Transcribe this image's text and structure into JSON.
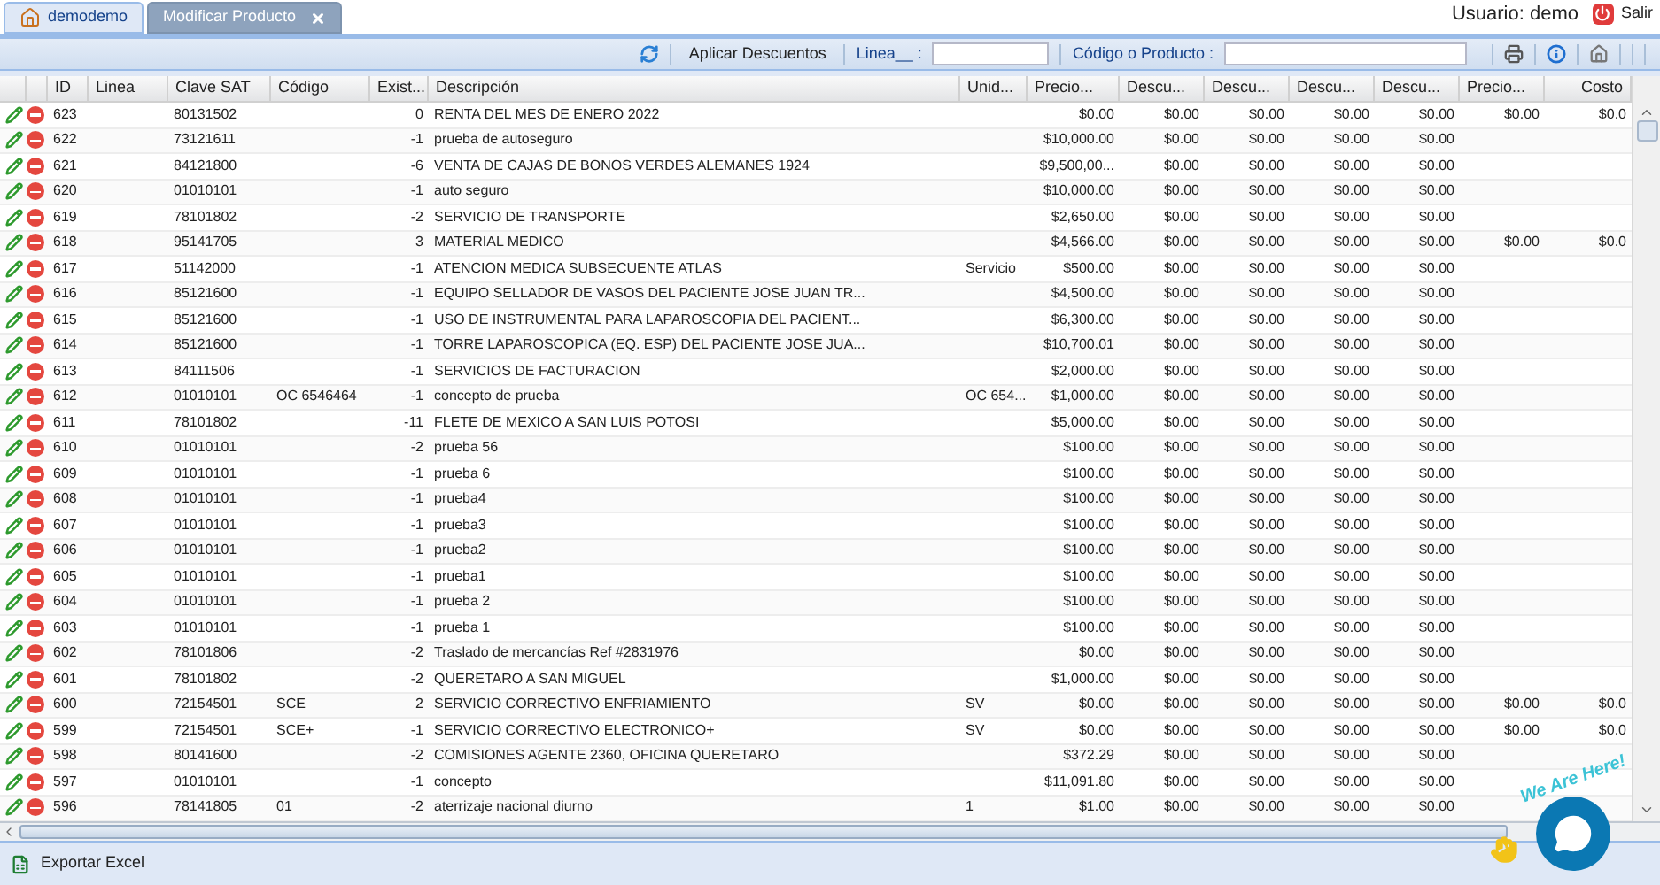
{
  "tabs": [
    {
      "label": "demodemo",
      "kind": "home",
      "selected": false
    },
    {
      "label": "Modificar Producto",
      "kind": "closable",
      "selected": true
    }
  ],
  "user": {
    "label": "Usuario: demo",
    "logout": "Salir"
  },
  "toolbar": {
    "apply_button": "Aplicar Descuentos",
    "linea_label": "Linea__ :",
    "product_label": "Código o Producto :"
  },
  "table": {
    "columns": [
      "ID",
      "Linea",
      "Clave SAT",
      "Código",
      "Exist...",
      "Descripción",
      "Unid...",
      "Precio...",
      "Descu...",
      "Descu...",
      "Descu...",
      "Descu...",
      "Precio...",
      "Costo"
    ],
    "rows": [
      {
        "id": "623",
        "clave_sat": "80131502",
        "existencia": "0",
        "descripcion": "RENTA DEL MES DE ENERO 2022",
        "precio": "$0.00",
        "descuentos": [
          "$0.00",
          "$0.00",
          "$0.00",
          "$0.00"
        ],
        "precio_2": "$0.00",
        "costo": "$0.0"
      },
      {
        "id": "622",
        "clave_sat": "73121611",
        "existencia": "-1",
        "descripcion": "prueba de autoseguro",
        "precio": "$10,000.00",
        "descuentos": [
          "$0.00",
          "$0.00",
          "$0.00",
          "$0.00"
        ]
      },
      {
        "id": "621",
        "clave_sat": "84121800",
        "existencia": "-6",
        "descripcion": "VENTA DE CAJAS DE BONOS VERDES ALEMANES 1924",
        "precio": "$9,500,00...",
        "descuentos": [
          "$0.00",
          "$0.00",
          "$0.00",
          "$0.00"
        ]
      },
      {
        "id": "620",
        "clave_sat": "01010101",
        "existencia": "-1",
        "descripcion": "auto seguro",
        "precio": "$10,000.00",
        "descuentos": [
          "$0.00",
          "$0.00",
          "$0.00",
          "$0.00"
        ]
      },
      {
        "id": "619",
        "clave_sat": "78101802",
        "existencia": "-2",
        "descripcion": "SERVICIO DE TRANSPORTE",
        "precio": "$2,650.00",
        "descuentos": [
          "$0.00",
          "$0.00",
          "$0.00",
          "$0.00"
        ]
      },
      {
        "id": "618",
        "clave_sat": "95141705",
        "existencia": "3",
        "descripcion": "MATERIAL MEDICO",
        "precio": "$4,566.00",
        "descuentos": [
          "$0.00",
          "$0.00",
          "$0.00",
          "$0.00"
        ],
        "precio_2": "$0.00",
        "costo": "$0.0"
      },
      {
        "id": "617",
        "clave_sat": "51142000",
        "existencia": "-1",
        "descripcion": "ATENCION MEDICA SUBSECUENTE ATLAS",
        "unidad": "Servicio",
        "precio": "$500.00",
        "descuentos": [
          "$0.00",
          "$0.00",
          "$0.00",
          "$0.00"
        ]
      },
      {
        "id": "616",
        "clave_sat": "85121600",
        "existencia": "-1",
        "descripcion": "EQUIPO SELLADOR DE VASOS DEL PACIENTE JOSE JUAN TR...",
        "precio": "$4,500.00",
        "descuentos": [
          "$0.00",
          "$0.00",
          "$0.00",
          "$0.00"
        ]
      },
      {
        "id": "615",
        "clave_sat": "85121600",
        "existencia": "-1",
        "descripcion": "USO DE INSTRUMENTAL PARA LAPAROSCOPIA DEL PACIENT...",
        "precio": "$6,300.00",
        "descuentos": [
          "$0.00",
          "$0.00",
          "$0.00",
          "$0.00"
        ]
      },
      {
        "id": "614",
        "clave_sat": "85121600",
        "existencia": "-1",
        "descripcion": "TORRE LAPAROSCOPICA (EQ. ESP) DEL PACIENTE JOSE JUA...",
        "precio": "$10,700.01",
        "descuentos": [
          "$0.00",
          "$0.00",
          "$0.00",
          "$0.00"
        ]
      },
      {
        "id": "613",
        "clave_sat": "84111506",
        "existencia": "-1",
        "descripcion": "SERVICIOS DE FACTURACION",
        "precio": "$2,000.00",
        "descuentos": [
          "$0.00",
          "$0.00",
          "$0.00",
          "$0.00"
        ]
      },
      {
        "id": "612",
        "clave_sat": "01010101",
        "codigo": "OC 6546464",
        "existencia": "-1",
        "descripcion": "concepto de prueba",
        "unidad": "OC 654...",
        "precio": "$1,000.00",
        "descuentos": [
          "$0.00",
          "$0.00",
          "$0.00",
          "$0.00"
        ]
      },
      {
        "id": "611",
        "clave_sat": "78101802",
        "existencia": "-11",
        "descripcion": "FLETE DE MEXICO A SAN LUIS POTOSI",
        "precio": "$5,000.00",
        "descuentos": [
          "$0.00",
          "$0.00",
          "$0.00",
          "$0.00"
        ]
      },
      {
        "id": "610",
        "clave_sat": "01010101",
        "existencia": "-2",
        "descripcion": "prueba 56",
        "precio": "$100.00",
        "descuentos": [
          "$0.00",
          "$0.00",
          "$0.00",
          "$0.00"
        ]
      },
      {
        "id": "609",
        "clave_sat": "01010101",
        "existencia": "-1",
        "descripcion": "prueba 6",
        "precio": "$100.00",
        "descuentos": [
          "$0.00",
          "$0.00",
          "$0.00",
          "$0.00"
        ]
      },
      {
        "id": "608",
        "clave_sat": "01010101",
        "existencia": "-1",
        "descripcion": "prueba4",
        "precio": "$100.00",
        "descuentos": [
          "$0.00",
          "$0.00",
          "$0.00",
          "$0.00"
        ]
      },
      {
        "id": "607",
        "clave_sat": "01010101",
        "existencia": "-1",
        "descripcion": "prueba3",
        "precio": "$100.00",
        "descuentos": [
          "$0.00",
          "$0.00",
          "$0.00",
          "$0.00"
        ]
      },
      {
        "id": "606",
        "clave_sat": "01010101",
        "existencia": "-1",
        "descripcion": "prueba2",
        "precio": "$100.00",
        "descuentos": [
          "$0.00",
          "$0.00",
          "$0.00",
          "$0.00"
        ]
      },
      {
        "id": "605",
        "clave_sat": "01010101",
        "existencia": "-1",
        "descripcion": "prueba1",
        "precio": "$100.00",
        "descuentos": [
          "$0.00",
          "$0.00",
          "$0.00",
          "$0.00"
        ]
      },
      {
        "id": "604",
        "clave_sat": "01010101",
        "existencia": "-1",
        "descripcion": "prueba 2",
        "precio": "$100.00",
        "descuentos": [
          "$0.00",
          "$0.00",
          "$0.00",
          "$0.00"
        ]
      },
      {
        "id": "603",
        "clave_sat": "01010101",
        "existencia": "-1",
        "descripcion": "prueba 1",
        "precio": "$100.00",
        "descuentos": [
          "$0.00",
          "$0.00",
          "$0.00",
          "$0.00"
        ]
      },
      {
        "id": "602",
        "clave_sat": "78101806",
        "existencia": "-2",
        "descripcion": "Traslado de mercancías Ref #2831976",
        "precio": "$0.00",
        "descuentos": [
          "$0.00",
          "$0.00",
          "$0.00",
          "$0.00"
        ]
      },
      {
        "id": "601",
        "clave_sat": "78101802",
        "existencia": "-2",
        "descripcion": "QUERETARO A SAN MIGUEL",
        "precio": "$1,000.00",
        "descuentos": [
          "$0.00",
          "$0.00",
          "$0.00",
          "$0.00"
        ]
      },
      {
        "id": "600",
        "clave_sat": "72154501",
        "codigo": "SCE",
        "existencia": "2",
        "descripcion": "SERVICIO CORRECTIVO ENFRIAMIENTO",
        "unidad": "SV",
        "precio": "$0.00",
        "descuentos": [
          "$0.00",
          "$0.00",
          "$0.00",
          "$0.00"
        ],
        "precio_2": "$0.00",
        "costo": "$0.0"
      },
      {
        "id": "599",
        "clave_sat": "72154501",
        "codigo": "SCE+",
        "existencia": "-1",
        "descripcion": "SERVICIO CORRECTIVO ELECTRONICO+",
        "unidad": "SV",
        "precio": "$0.00",
        "descuentos": [
          "$0.00",
          "$0.00",
          "$0.00",
          "$0.00"
        ],
        "precio_2": "$0.00",
        "costo": "$0.0"
      },
      {
        "id": "598",
        "clave_sat": "80141600",
        "existencia": "-2",
        "descripcion": "COMISIONES AGENTE 2360, OFICINA QUERETARO",
        "precio": "$372.29",
        "descuentos": [
          "$0.00",
          "$0.00",
          "$0.00",
          "$0.00"
        ]
      },
      {
        "id": "597",
        "clave_sat": "01010101",
        "existencia": "-1",
        "descripcion": "concepto",
        "precio": "$11,091.80",
        "descuentos": [
          "$0.00",
          "$0.00",
          "$0.00",
          "$0.00"
        ]
      },
      {
        "id": "596",
        "clave_sat": "78141805",
        "codigo": "01",
        "existencia": "-2",
        "descripcion": "aterrizaje nacional diurno",
        "unidad": "1",
        "precio": "$1.00",
        "descuentos": [
          "$0.00",
          "$0.00",
          "$0.00",
          "$0.00"
        ]
      }
    ]
  },
  "footer": {
    "export_button": "Exportar Excel"
  },
  "chat_widget": {
    "label": "We Are Here!"
  }
}
